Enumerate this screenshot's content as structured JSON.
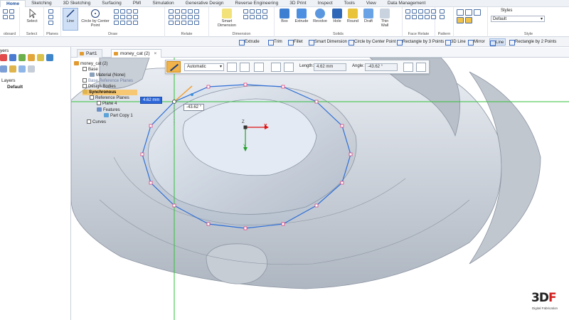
{
  "ribbon": {
    "tabs": [
      "Home",
      "Sketching",
      "3D Sketching",
      "Surfacing",
      "PMI",
      "Simulation",
      "Generative Design",
      "Reverse Engineering",
      "3D Print",
      "Inspect",
      "Tools",
      "View",
      "Data Management"
    ],
    "active_tab": "Home",
    "groups": {
      "clipboard": "oboard",
      "select": "Select",
      "planes": "Planes",
      "draw": "Draw",
      "relate": "Relate",
      "dimension": "Dimension",
      "solids": "Solids",
      "face_relate": "Face Relate",
      "pattern": "Pattern",
      "style": "Style"
    },
    "buttons": {
      "select": "Select",
      "line": "Line",
      "circle": "Circle by Center Point",
      "smart_dimension": "Smart Dimension",
      "box": "Box",
      "extrude": "Extrude",
      "revolve": "Revolve",
      "hole": "Hole",
      "round": "Round",
      "draft": "Draft",
      "thin_wall": "Thin Wall"
    },
    "styles_label": "Styles",
    "style_value": "Default"
  },
  "subbar": {
    "items": [
      "Extrude",
      "Trim",
      "Fillet",
      "Smart Dimension",
      "Circle by Center Point",
      "Rectangle by 3 Points",
      "3D Line",
      "Mirror",
      "Line",
      "Rectangle by 2 Points"
    ],
    "active": "Line"
  },
  "left_panel": {
    "title": "yers",
    "layers_label": "Layers",
    "default_label": "Default"
  },
  "doc_tabs": [
    {
      "label": "Part1",
      "active": false
    },
    {
      "label": "money_cat (2)",
      "active": true
    }
  ],
  "close_glyph": "×",
  "sketch_toolbar": {
    "mode": "Automatic",
    "length_label": "Length:",
    "length_value": "4.62 mm",
    "angle_label": "Angle:",
    "angle_value": "-43.62 °"
  },
  "tree": {
    "rows": [
      "money_cat (2)",
      "Base",
      "Material (None)",
      "Base Reference Planes",
      "Design Bodies",
      "Synchronous",
      "Reference Planes",
      "Plane 4",
      "Features",
      "Part Copy 1",
      "Curves"
    ]
  },
  "dimensions": {
    "length_popup": "4.62 mm",
    "angle_popup": "-43.62 °"
  },
  "axes": {
    "x": "X",
    "y": "Y",
    "z": "Z"
  },
  "logo": {
    "text_main": "3D",
    "text_accent": "F",
    "subtitle": "Digital Fabrication"
  },
  "colors": {
    "accent": "#f0b24a",
    "sketch": "#2f6fd6",
    "handles": "#e0407a",
    "plane": "#33c03a",
    "brand_red": "#d21f1f"
  }
}
